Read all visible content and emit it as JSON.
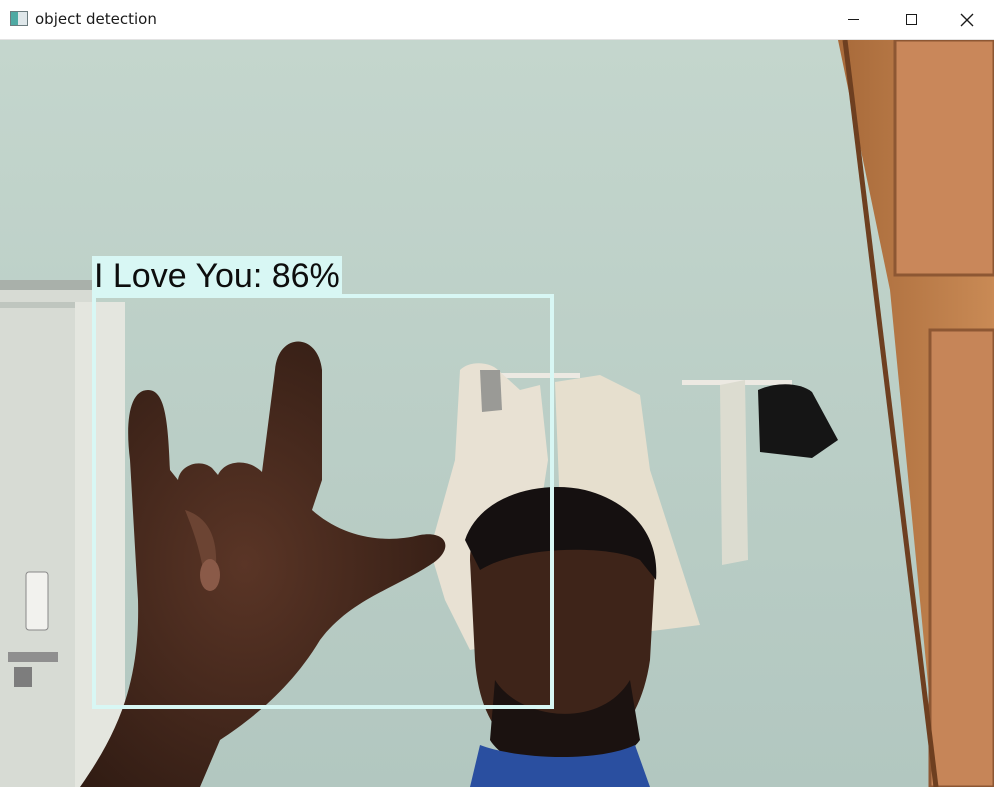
{
  "window": {
    "title": "object detection",
    "icon": "app-window-icon",
    "controls": [
      "minimize-icon",
      "maximize-icon",
      "close-icon"
    ]
  },
  "detection": {
    "label": "I Love You: 86%",
    "class_name": "I Love You",
    "confidence_percent": 86,
    "box_color": "#d8f7f4"
  }
}
